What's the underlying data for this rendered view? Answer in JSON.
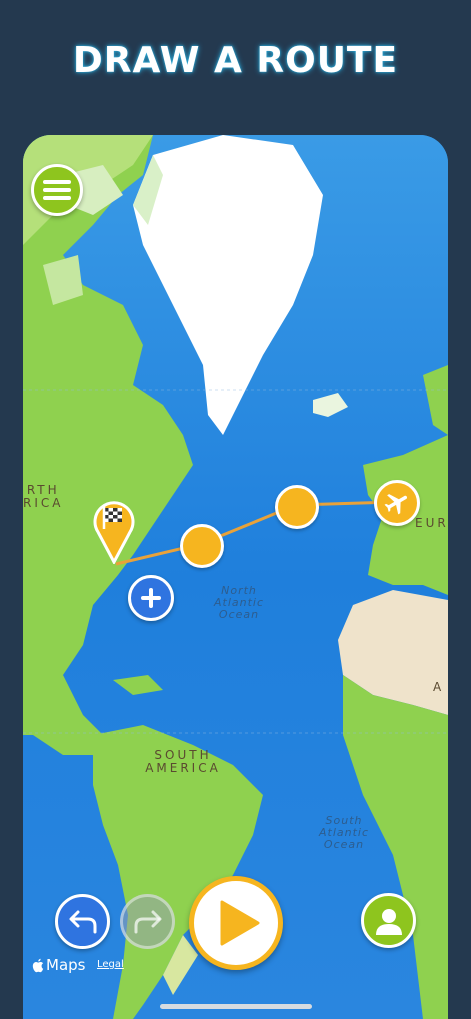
{
  "header": {
    "title": "DRAW A ROUTE"
  },
  "map": {
    "labels": {
      "north_america": "RTH\nRICA",
      "north_america_line1": "RTH",
      "north_america_line2": "RICA",
      "north_atlantic_line1": "North",
      "north_atlantic_line2": "Atlantic",
      "north_atlantic_line3": "Ocean",
      "south_america_line1": "SOUTH",
      "south_america_line2": "AMERICA",
      "south_atlantic_line1": "South",
      "south_atlantic_line2": "Atlantic",
      "south_atlantic_line3": "Ocean",
      "europe_partial": "EUR",
      "africa_partial": "A"
    },
    "route_color": "#e8a23a",
    "waypoint_color": "#f6b51f"
  },
  "controls": {
    "menu_icon": "hamburger-menu-icon",
    "add_icon": "plus-icon",
    "undo_icon": "undo-arrow-icon",
    "redo_icon": "redo-arrow-icon",
    "play_icon": "play-icon",
    "profile_icon": "user-profile-icon",
    "start_marker_icon": "checkered-flag-icon",
    "end_marker_icon": "airplane-icon"
  },
  "attribution": {
    "maps_label": "Maps",
    "legal_label": "Legal"
  },
  "colors": {
    "background": "#24394f",
    "accent_green": "#8ec51e",
    "accent_blue": "#2f74e0",
    "accent_yellow": "#f6b51f"
  }
}
